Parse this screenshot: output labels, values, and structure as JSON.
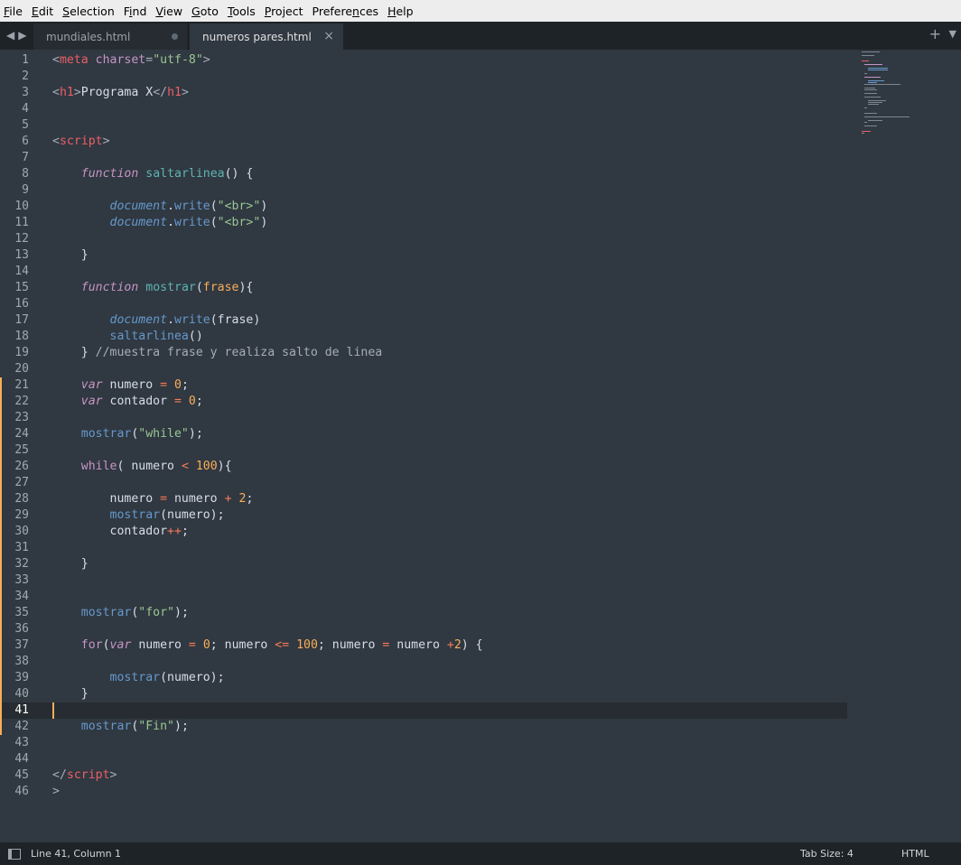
{
  "menu": {
    "items": [
      {
        "label": "File",
        "key": "F"
      },
      {
        "label": "Edit",
        "key": "E"
      },
      {
        "label": "Selection",
        "key": "S"
      },
      {
        "label": "Find",
        "key": "i"
      },
      {
        "label": "View",
        "key": "V"
      },
      {
        "label": "Goto",
        "key": "G"
      },
      {
        "label": "Tools",
        "key": "T"
      },
      {
        "label": "Project",
        "key": "P"
      },
      {
        "label": "Preferences",
        "key": "n"
      },
      {
        "label": "Help",
        "key": "H"
      }
    ]
  },
  "tabs": [
    {
      "label": "mundiales.html",
      "state": "modified"
    },
    {
      "label": "numeros pares.html",
      "state": "active"
    }
  ],
  "tab_bar": {
    "new_tab_icon": "plus-icon",
    "tab_list_icon": "chevron-down-icon",
    "nav_icons": [
      "triangle-left-icon",
      "triangle-right-icon"
    ]
  },
  "editor": {
    "active_line": 41,
    "lines": [
      [
        [
          "t-punc",
          "<"
        ],
        [
          "t-tag",
          "meta"
        ],
        [
          "t-txt",
          " "
        ],
        [
          "t-attr",
          "charset"
        ],
        [
          "t-punc",
          "="
        ],
        [
          "t-str",
          "\"utf-8\""
        ],
        [
          "t-punc",
          ">"
        ]
      ],
      [],
      [
        [
          "t-punc",
          "<"
        ],
        [
          "t-tag",
          "h1"
        ],
        [
          "t-punc",
          ">"
        ],
        [
          "t-txt",
          "Programa X"
        ],
        [
          "t-punc",
          "</"
        ],
        [
          "t-tag",
          "h1"
        ],
        [
          "t-punc",
          ">"
        ]
      ],
      [],
      [],
      [
        [
          "t-punc",
          "<"
        ],
        [
          "t-tag",
          "script"
        ],
        [
          "t-punc",
          ">"
        ]
      ],
      [],
      [
        [
          "t-txt",
          "    "
        ],
        [
          "t-kw",
          "function"
        ],
        [
          "t-txt",
          " "
        ],
        [
          "t-fn",
          "saltarlinea"
        ],
        [
          "t-txt",
          "() {"
        ]
      ],
      [],
      [
        [
          "t-txt",
          "        "
        ],
        [
          "t-obj",
          "document"
        ],
        [
          "t-txt",
          "."
        ],
        [
          "t-call",
          "write"
        ],
        [
          "t-txt",
          "("
        ],
        [
          "t-str",
          "\"<br>\""
        ],
        [
          "t-txt",
          ")"
        ]
      ],
      [
        [
          "t-txt",
          "        "
        ],
        [
          "t-obj",
          "document"
        ],
        [
          "t-txt",
          "."
        ],
        [
          "t-call",
          "write"
        ],
        [
          "t-txt",
          "("
        ],
        [
          "t-str",
          "\"<br>\""
        ],
        [
          "t-txt",
          ")"
        ]
      ],
      [],
      [
        [
          "t-txt",
          "    }"
        ]
      ],
      [],
      [
        [
          "t-txt",
          "    "
        ],
        [
          "t-kw",
          "function"
        ],
        [
          "t-txt",
          " "
        ],
        [
          "t-fn",
          "mostrar"
        ],
        [
          "t-txt",
          "("
        ],
        [
          "t-param",
          "frase"
        ],
        [
          "t-txt",
          "){"
        ]
      ],
      [],
      [
        [
          "t-txt",
          "        "
        ],
        [
          "t-obj",
          "document"
        ],
        [
          "t-txt",
          "."
        ],
        [
          "t-call",
          "write"
        ],
        [
          "t-txt",
          "(frase)"
        ]
      ],
      [
        [
          "t-txt",
          "        "
        ],
        [
          "t-call",
          "saltarlinea"
        ],
        [
          "t-txt",
          "()"
        ]
      ],
      [
        [
          "t-txt",
          "    } "
        ],
        [
          "t-cm",
          "//muestra frase y realiza salto de linea"
        ]
      ],
      [],
      [
        [
          "t-txt",
          "    "
        ],
        [
          "t-kw",
          "var"
        ],
        [
          "t-txt",
          " numero "
        ],
        [
          "t-op",
          "="
        ],
        [
          "t-txt",
          " "
        ],
        [
          "t-num",
          "0"
        ],
        [
          "t-txt",
          ";"
        ]
      ],
      [
        [
          "t-txt",
          "    "
        ],
        [
          "t-kw",
          "var"
        ],
        [
          "t-txt",
          " contador "
        ],
        [
          "t-op",
          "="
        ],
        [
          "t-txt",
          " "
        ],
        [
          "t-num",
          "0"
        ],
        [
          "t-txt",
          ";"
        ]
      ],
      [],
      [
        [
          "t-txt",
          "    "
        ],
        [
          "t-call",
          "mostrar"
        ],
        [
          "t-txt",
          "("
        ],
        [
          "t-str",
          "\"while\""
        ],
        [
          "t-txt",
          ");"
        ]
      ],
      [],
      [
        [
          "t-txt",
          "    "
        ],
        [
          "t-ctrl",
          "while"
        ],
        [
          "t-txt",
          "( numero "
        ],
        [
          "t-op",
          "<"
        ],
        [
          "t-txt",
          " "
        ],
        [
          "t-num",
          "100"
        ],
        [
          "t-txt",
          "){"
        ]
      ],
      [],
      [
        [
          "t-txt",
          "        numero "
        ],
        [
          "t-op",
          "="
        ],
        [
          "t-txt",
          " numero "
        ],
        [
          "t-op",
          "+"
        ],
        [
          "t-txt",
          " "
        ],
        [
          "t-num",
          "2"
        ],
        [
          "t-txt",
          ";"
        ]
      ],
      [
        [
          "t-txt",
          "        "
        ],
        [
          "t-call",
          "mostrar"
        ],
        [
          "t-txt",
          "(numero);"
        ]
      ],
      [
        [
          "t-txt",
          "        contador"
        ],
        [
          "t-op",
          "++"
        ],
        [
          "t-txt",
          ";"
        ]
      ],
      [],
      [
        [
          "t-txt",
          "    }"
        ]
      ],
      [],
      [],
      [
        [
          "t-txt",
          "    "
        ],
        [
          "t-call",
          "mostrar"
        ],
        [
          "t-txt",
          "("
        ],
        [
          "t-str",
          "\"for\""
        ],
        [
          "t-txt",
          ");"
        ]
      ],
      [],
      [
        [
          "t-txt",
          "    "
        ],
        [
          "t-ctrl",
          "for"
        ],
        [
          "t-txt",
          "("
        ],
        [
          "t-kw",
          "var"
        ],
        [
          "t-txt",
          " numero "
        ],
        [
          "t-op",
          "="
        ],
        [
          "t-txt",
          " "
        ],
        [
          "t-num",
          "0"
        ],
        [
          "t-txt",
          "; numero "
        ],
        [
          "t-op",
          "<="
        ],
        [
          "t-txt",
          " "
        ],
        [
          "t-num",
          "100"
        ],
        [
          "t-txt",
          "; numero "
        ],
        [
          "t-op",
          "="
        ],
        [
          "t-txt",
          " numero "
        ],
        [
          "t-op",
          "+"
        ],
        [
          "t-num",
          "2"
        ],
        [
          "t-txt",
          ") {"
        ]
      ],
      [],
      [
        [
          "t-txt",
          "        "
        ],
        [
          "t-call",
          "mostrar"
        ],
        [
          "t-txt",
          "(numero);"
        ]
      ],
      [
        [
          "t-txt",
          "    }"
        ]
      ],
      [],
      [
        [
          "t-txt",
          "    "
        ],
        [
          "t-call",
          "mostrar"
        ],
        [
          "t-txt",
          "("
        ],
        [
          "t-str",
          "\"Fin\""
        ],
        [
          "t-txt",
          ");"
        ]
      ],
      [],
      [],
      [
        [
          "t-punc",
          "</"
        ],
        [
          "t-tag",
          "script"
        ],
        [
          "t-punc",
          ">"
        ]
      ],
      [
        [
          "t-punc",
          ">"
        ]
      ]
    ]
  },
  "status": {
    "position": "Line 41, Column 1",
    "tab_size": "Tab Size: 4",
    "syntax": "HTML",
    "panel_icon": "panel-toggle-icon"
  }
}
